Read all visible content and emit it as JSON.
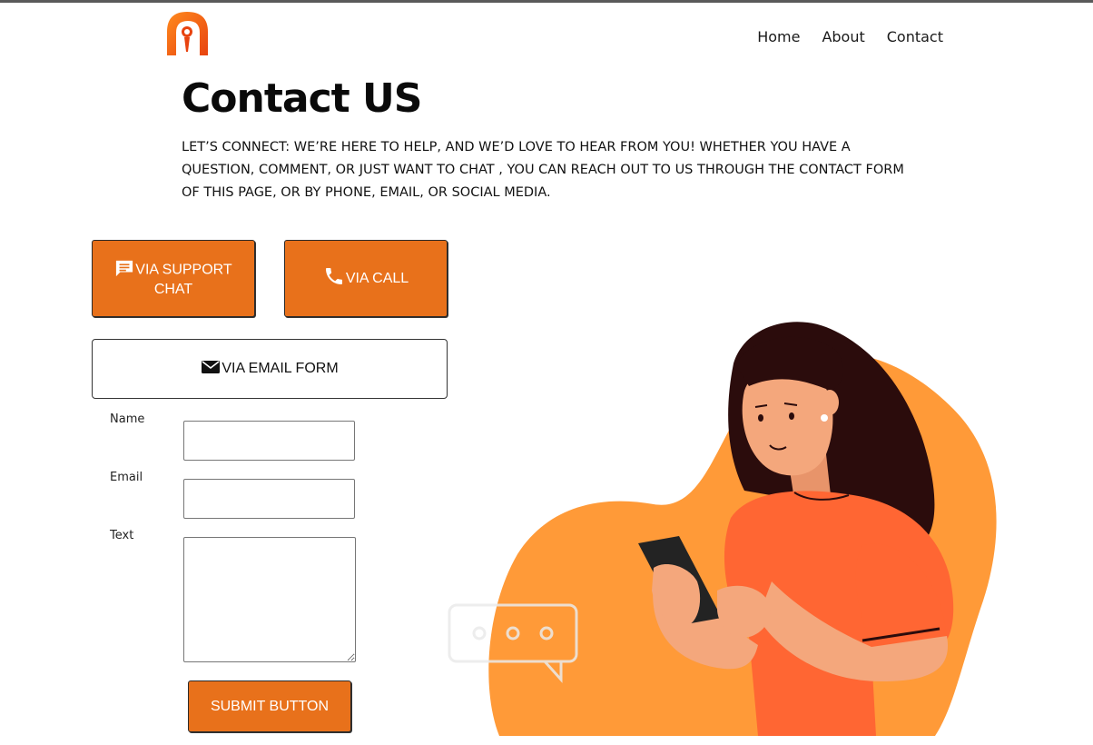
{
  "header": {
    "logo_icon": "brand-logo-icon",
    "nav": [
      {
        "label": "Home"
      },
      {
        "label": "About"
      },
      {
        "label": "Contact"
      }
    ]
  },
  "page": {
    "title": "Contact US",
    "intro": "LET’S CONNECT: WE’RE HERE TO HELP, AND WE’D LOVE TO HEAR FROM YOU! WHETHER YOU HAVE A QUESTION, COMMENT, OR JUST WANT TO CHAT , YOU CAN REACH OUT TO US THROUGH THE CONTACT FORM OF THIS PAGE, OR BY PHONE, EMAIL, OR SOCIAL MEDIA."
  },
  "contact_options": {
    "support_chat": {
      "label_line1": "VIA SUPPORT",
      "label_line2": "CHAT",
      "icon": "chat-icon"
    },
    "call": {
      "label": "VIA CALL",
      "icon": "phone-icon"
    },
    "email": {
      "label": "VIA EMAIL FORM",
      "icon": "envelope-icon"
    }
  },
  "form": {
    "name_label": "Name",
    "name_value": "",
    "email_label": "Email",
    "email_value": "",
    "text_label": "Text",
    "text_value": "",
    "submit_label": "SUBMIT BUTTON"
  },
  "colors": {
    "accent": "#e8711b",
    "blob": "#ff9a38",
    "shirt": "#ff6633",
    "hair": "#2b0c0c",
    "skin": "#f4a77c"
  },
  "illustration": {
    "subject": "woman-using-phone-illustration"
  }
}
